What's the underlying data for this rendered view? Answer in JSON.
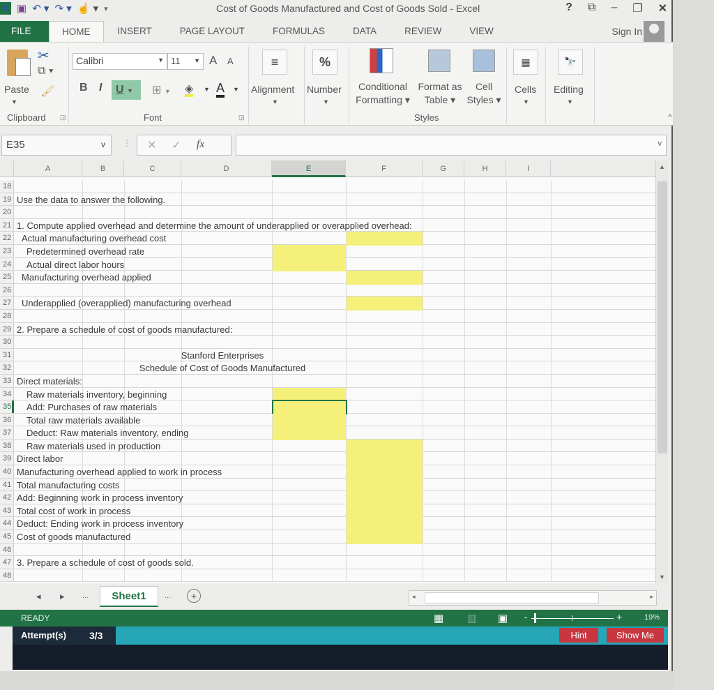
{
  "titlebar": {
    "title": "Cost of Goods Manufactured and Cost of Goods Sold - Excel",
    "help": "?",
    "ribbon_display": "⧉",
    "minimize": "–",
    "restore": "🗗",
    "close": "✕"
  },
  "tabs": [
    "FILE",
    "HOME",
    "INSERT",
    "PAGE LAYOUT",
    "FORMULAS",
    "DATA",
    "REVIEW",
    "VIEW"
  ],
  "sign_in": "Sign In",
  "ribbon": {
    "clipboard": {
      "paste": "Paste",
      "label": "Clipboard"
    },
    "font": {
      "name": "Calibri",
      "size": "11",
      "bold": "B",
      "italic": "I",
      "underline": "U",
      "label": "Font",
      "grow": "A",
      "shrink": "A",
      "font_color": "A"
    },
    "alignment": "Alignment",
    "number": "Number",
    "percent": "%",
    "conditional_formatting": [
      "Conditional",
      "Formatting ▾"
    ],
    "format_as_table": [
      "Format as",
      "Table ▾"
    ],
    "cell_styles": [
      "Cell",
      "Styles ▾"
    ],
    "styles_label": "Styles",
    "cells": "Cells",
    "editing": "Editing"
  },
  "formula_bar": {
    "name_box": "E35",
    "cancel": "✕",
    "enter": "✓",
    "fx": "fx",
    "value": ""
  },
  "columns": [
    "A",
    "B",
    "C",
    "D",
    "E",
    "F",
    "G",
    "H",
    "I"
  ],
  "selected_column": "E",
  "selected_row": "35",
  "rows": [
    {
      "n": "18",
      "a": "",
      "indent": 0
    },
    {
      "n": "19",
      "a": "Use the data to answer the following.",
      "indent": 0
    },
    {
      "n": "20",
      "a": "",
      "indent": 0
    },
    {
      "n": "21",
      "a": "1. Compute applied overhead and determine the amount of underapplied or overapplied overhead:",
      "indent": 0
    },
    {
      "n": "22",
      "a": "Actual manufacturing overhead cost",
      "indent": 1
    },
    {
      "n": "23",
      "a": "Predetermined overhead rate",
      "indent": 2
    },
    {
      "n": "24",
      "a": "Actual direct labor hours",
      "indent": 2
    },
    {
      "n": "25",
      "a": "Manufacturing overhead applied",
      "indent": 1
    },
    {
      "n": "26",
      "a": "",
      "indent": 0
    },
    {
      "n": "27",
      "a": "Underapplied (overapplied) manufacturing overhead",
      "indent": 1
    },
    {
      "n": "28",
      "a": "",
      "indent": 0
    },
    {
      "n": "29",
      "a": "2. Prepare a schedule of cost of goods manufactured:",
      "indent": 0
    },
    {
      "n": "30",
      "a": "",
      "indent": 0
    },
    {
      "n": "31",
      "center": "Stanford Enterprises"
    },
    {
      "n": "32",
      "center": "Schedule of Cost of Goods Manufactured"
    },
    {
      "n": "33",
      "a": "Direct materials:",
      "indent": 0
    },
    {
      "n": "34",
      "a": "Raw materials inventory, beginning",
      "indent": 2
    },
    {
      "n": "35",
      "a": "Add: Purchases of raw materials",
      "indent": 2
    },
    {
      "n": "36",
      "a": "Total raw materials available",
      "indent": 2
    },
    {
      "n": "37",
      "a": "Deduct: Raw materials inventory, ending",
      "indent": 2
    },
    {
      "n": "38",
      "a": "Raw materials used in production",
      "indent": 2
    },
    {
      "n": "39",
      "a": "Direct labor",
      "indent": 0
    },
    {
      "n": "40",
      "a": "Manufacturing overhead applied to work in process",
      "indent": 0
    },
    {
      "n": "41",
      "a": "Total manufacturing costs",
      "indent": 0
    },
    {
      "n": "42",
      "a": "Add: Beginning work in process inventory",
      "indent": 0
    },
    {
      "n": "43",
      "a": "Total cost of work in process",
      "indent": 0
    },
    {
      "n": "44",
      "a": "Deduct: Ending work in process inventory",
      "indent": 0
    },
    {
      "n": "45",
      "a": "Cost of goods manufactured",
      "indent": 0
    },
    {
      "n": "46",
      "a": "",
      "indent": 0
    },
    {
      "n": "47",
      "a": "3. Prepare a schedule of cost of goods sold.",
      "indent": 0
    },
    {
      "n": "48",
      "a": "",
      "indent": 0
    }
  ],
  "sheet_tabs": {
    "prev": "◂",
    "next": "▸",
    "ellipsis": "...",
    "active": "Sheet1",
    "add": "+"
  },
  "status": {
    "text": "READY",
    "zoom": "19%"
  },
  "attempts": {
    "label": "Attempt(s)",
    "value": "3/3"
  },
  "buttons": {
    "hint": "Hint",
    "show_me": "Show Me"
  },
  "colors": {
    "excel_green": "#217346",
    "input_yellow": "#f4f07a",
    "attempt_bar": "#27a6b8",
    "button_red": "#c8363f"
  }
}
